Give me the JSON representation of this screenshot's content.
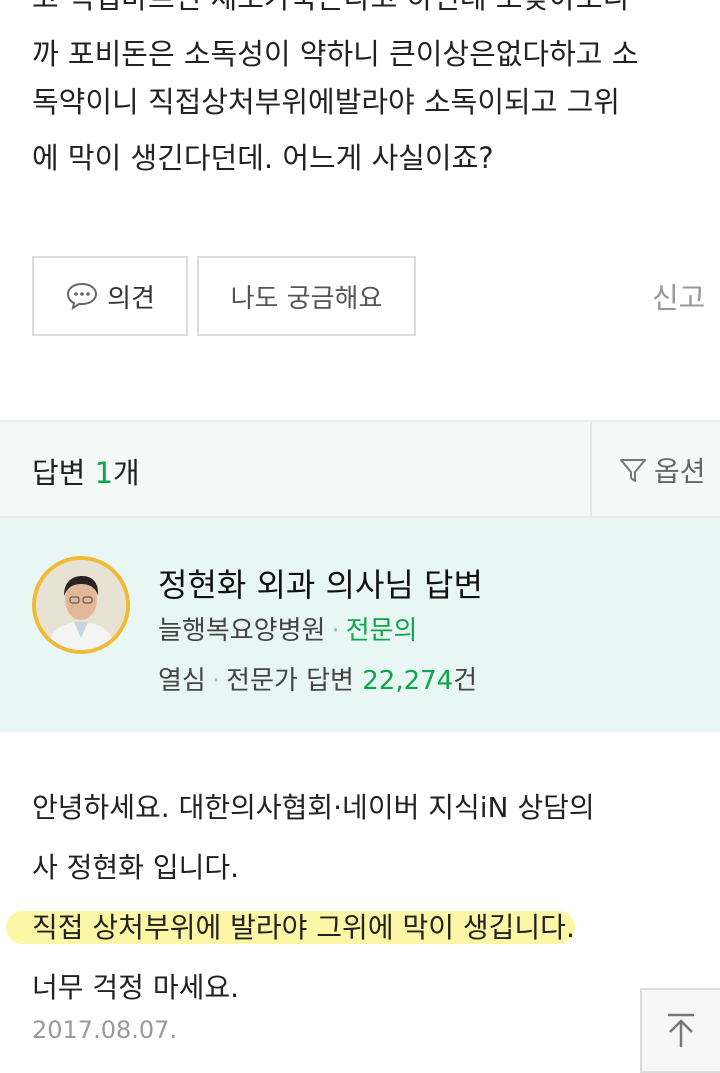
{
  "question": {
    "lines": [
      "고 직접바르면 세포가죽는다고 하던데 또찾아보니",
      "까 포비돈은 소독성이 약하니 큰이상은없다하고 소",
      "독약이니 직접상처부위에발라야 소독이되고 그위",
      "에 막이 생긴다던데. 어느게 사실이죠?"
    ]
  },
  "actions": {
    "opinion_label": "의견",
    "curious_label": "나도 궁금해요",
    "report_label": "신고"
  },
  "answers_header": {
    "label": "답변",
    "count": "1",
    "unit": "개",
    "options_label": "옵션"
  },
  "expert": {
    "title": "정현화 외과 의사님 답변",
    "hospital": "늘행복요양병원",
    "role": "전문의",
    "badge": "열심",
    "stat_label": "전문가 답변",
    "answer_count": "22,274",
    "answer_unit": "건"
  },
  "answer": {
    "line1": "안녕하세요. 대한의사협회·네이버 지식iN 상담의",
    "line2": "사 정현화 입니다.",
    "highlight": "직접 상처부위에 발라야 그위에 막이 생깁니다.",
    "line4": "너무 걱정 마세요.",
    "date": "2017.08.07."
  },
  "colors": {
    "accent_green": "#0aa847",
    "expert_bg": "#e8f7f3",
    "highlight": "#fcf7a6",
    "avatar_ring": "#f2b935"
  }
}
